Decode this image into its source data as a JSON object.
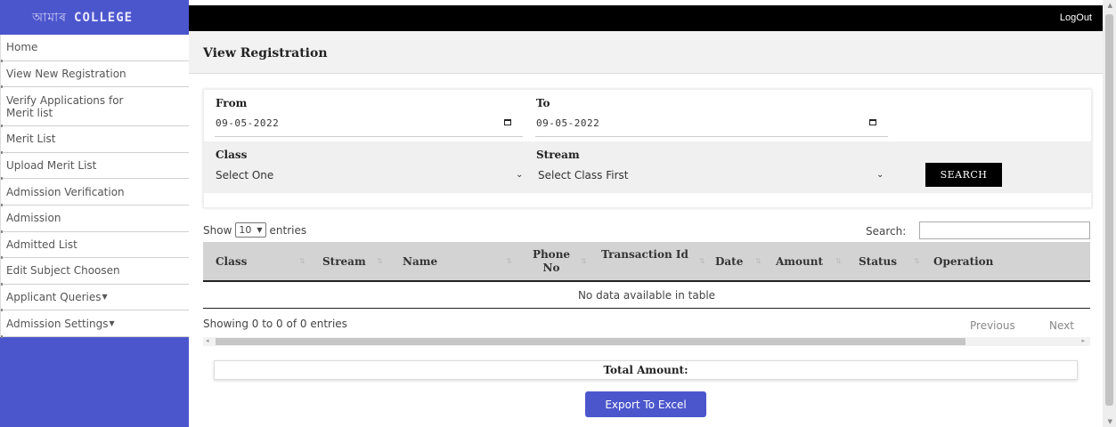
{
  "brand": {
    "prefix": "আমাৰ",
    "name": "COLLEGE"
  },
  "topbar": {
    "logout": "LogOut"
  },
  "sidebar": {
    "items": [
      {
        "label": "Home"
      },
      {
        "label": "View New Registration"
      },
      {
        "label": "Verify Applications for Merit list"
      },
      {
        "label": "Merit List"
      },
      {
        "label": "Upload Merit List"
      },
      {
        "label": "Admission Verification"
      },
      {
        "label": "Admission"
      },
      {
        "label": "Admitted List"
      },
      {
        "label": "Edit Subject Choosen"
      },
      {
        "label": "Applicant Queries"
      },
      {
        "label": "Admission Settings"
      }
    ]
  },
  "header": {
    "title": "View Registration"
  },
  "filters": {
    "from_label": "From",
    "from_value": "09-05-2022",
    "to_label": "To",
    "to_value": "09-05-2022",
    "class_label": "Class",
    "class_value": "Select One",
    "stream_label": "Stream",
    "stream_value": "Select Class First",
    "search_button": "SEARCH"
  },
  "table": {
    "show_label": "Show",
    "length_value": "10",
    "entries_label": "entries",
    "search_label": "Search:",
    "columns": [
      "Class",
      "Stream",
      "Name",
      "Phone No",
      "Transaction Id",
      "Date",
      "Amount",
      "Status",
      "Operation"
    ],
    "empty_text": "No data available in table",
    "info": "Showing 0 to 0 of 0 entries",
    "previous": "Previous",
    "next": "Next"
  },
  "footer": {
    "total_label": "Total Amount:",
    "export_button": "Export To Excel"
  },
  "colors": {
    "accent": "#4c56cc",
    "topbar": "#000000",
    "table_header": "#d3d3d3"
  }
}
